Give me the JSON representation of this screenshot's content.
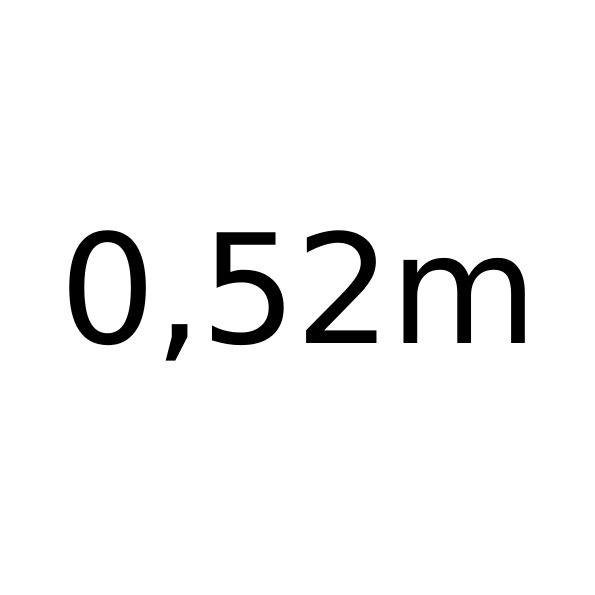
{
  "measurement": {
    "text": "0,52m"
  }
}
